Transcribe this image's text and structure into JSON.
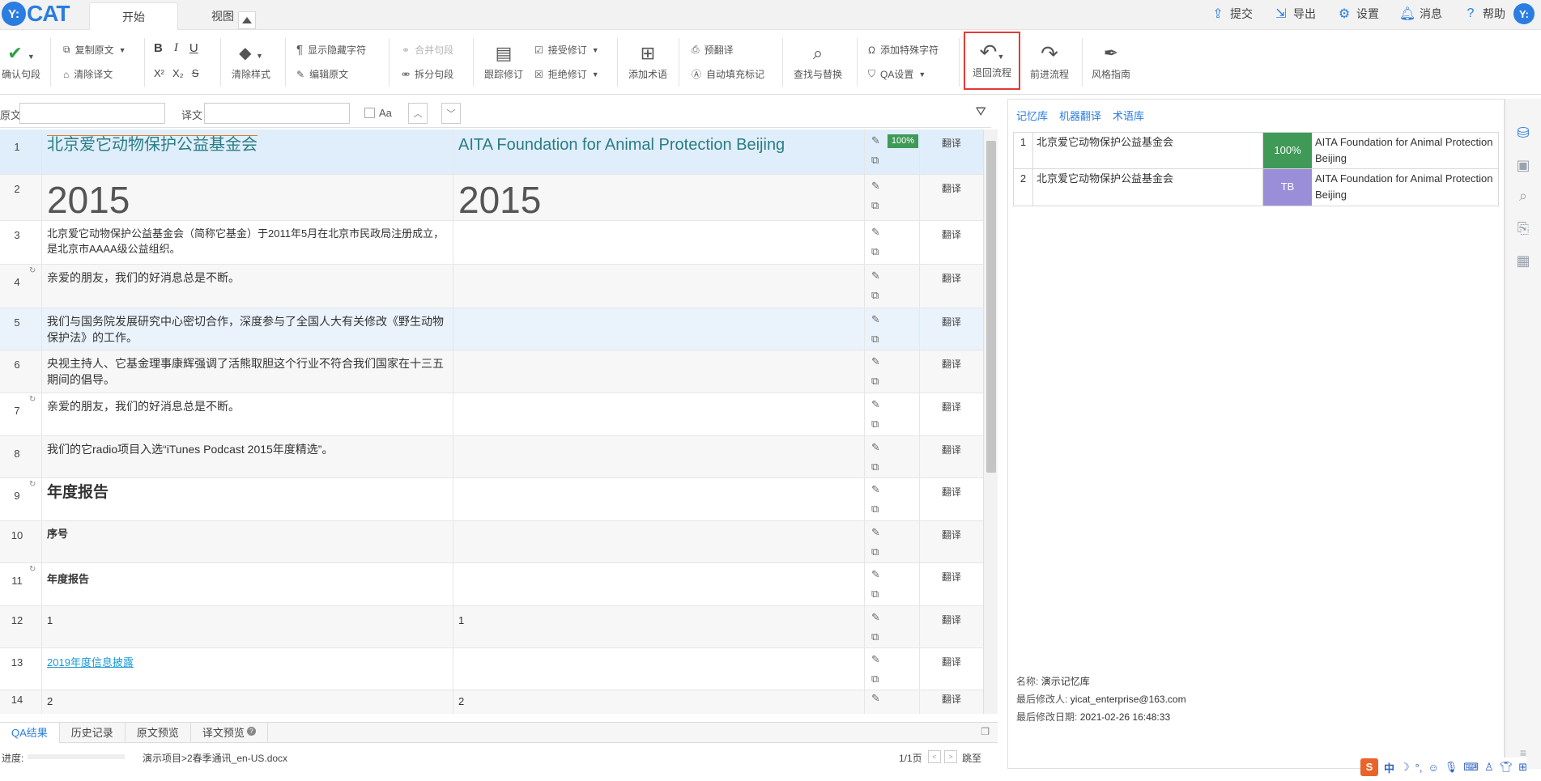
{
  "app": {
    "logo_text": "CAT",
    "logo_badge": "Y:",
    "avatar": "Y:"
  },
  "tabs": [
    {
      "label": "开始",
      "active": true
    },
    {
      "label": "视图",
      "active": false
    }
  ],
  "top_actions": [
    {
      "label": "提交",
      "icon": "upload-icon"
    },
    {
      "label": "导出",
      "icon": "export-icon"
    },
    {
      "label": "设置",
      "icon": "gear-icon"
    },
    {
      "label": "消息",
      "icon": "bell-icon"
    },
    {
      "label": "帮助",
      "icon": "help-icon"
    }
  ],
  "toolbar": {
    "confirm": "确认句段",
    "copy_source": "复制原文",
    "clear_target": "清除译文",
    "clear_style": "清除样式",
    "show_hidden": "显示隐藏字符",
    "edit_source": "编辑原文",
    "merge": "合并句段",
    "split": "拆分句段",
    "track": "跟踪修订",
    "accept": "接受修订",
    "reject": "拒绝修订",
    "add_term": "添加术语",
    "pretranslate": "预翻译",
    "autofill": "自动填充标记",
    "find_replace": "查找与替换",
    "special_char": "添加特殊字符",
    "qa_settings": "QA设置",
    "rollback": "退回流程",
    "forward": "前进流程",
    "style_guide": "风格指南",
    "format_labels": {
      "bold": "B",
      "italic": "I",
      "underline": "U",
      "superscript": "X²",
      "subscript": "X₂",
      "strike": "S"
    }
  },
  "search": {
    "source_label": "原文",
    "target_label": "译文",
    "case_label": "Aa"
  },
  "segments": [
    {
      "num": "1",
      "source": "北京爱它动物保护公益基金会",
      "target": "AITA Foundation for Animal Protection Beijing",
      "match": "100%",
      "status": "翻译"
    },
    {
      "num": "2",
      "source": "2015",
      "target": "2015",
      "status": "翻译"
    },
    {
      "num": "3",
      "source": "北京爱它动物保护公益基金会（简称它基金）于2011年5月在北京市民政局注册成立，是北京市AAAA级公益组织。",
      "target": "",
      "status": "翻译"
    },
    {
      "num": "4",
      "source": "亲爱的朋友，我们的好消息总是不断。",
      "target": "",
      "status": "翻译"
    },
    {
      "num": "5",
      "source": "我们与国务院发展研究中心密切合作，深度参与了全国人大有关修改《野生动物保护法》的工作。",
      "target": "",
      "status": "翻译"
    },
    {
      "num": "6",
      "source": "央视主持人、它基金理事康辉强调了活熊取胆这个行业不符合我们国家在十三五期间的倡导。",
      "target": "",
      "status": "翻译"
    },
    {
      "num": "7",
      "source": "亲爱的朋友，我们的好消息总是不断。",
      "target": "",
      "status": "翻译"
    },
    {
      "num": "8",
      "source": "我们的它radio项目入选“iTunes Podcast 2015年度精选”。",
      "target": "",
      "status": "翻译"
    },
    {
      "num": "9",
      "source": "年度报告",
      "target": "",
      "status": "翻译"
    },
    {
      "num": "10",
      "source": "序号",
      "target": "",
      "status": "翻译"
    },
    {
      "num": "11",
      "source": "年度报告",
      "target": "",
      "status": "翻译"
    },
    {
      "num": "12",
      "source": "1",
      "target": "1",
      "status": "翻译"
    },
    {
      "num": "13",
      "source": "2019年度信息披露",
      "target": "",
      "status": "翻译"
    },
    {
      "num": "14",
      "source": "2",
      "target": "2",
      "status": "翻译"
    }
  ],
  "bottom_tabs": [
    {
      "label": "QA结果",
      "active": true
    },
    {
      "label": "历史记录",
      "active": false
    },
    {
      "label": "原文预览",
      "active": false
    },
    {
      "label": "译文预览",
      "active": false
    }
  ],
  "status": {
    "progress_label": "进度:",
    "path": "演示项目>2春季通讯_en-US.docx",
    "page": "1/1页",
    "jump": "跳至"
  },
  "right_panel": {
    "tabs": [
      "记忆库",
      "机器翻译",
      "术语库"
    ],
    "matches": [
      {
        "num": "1",
        "source": "北京爱它动物保护公益基金会",
        "score": "100%",
        "target": "AITA Foundation for Animal Protection Beijing",
        "color": "#3f9a57"
      },
      {
        "num": "2",
        "source": "北京爱它动物保护公益基金会",
        "score": "TB",
        "target": "AITA Foundation for Animal Protection Beijing",
        "color": "#9b8ed8"
      }
    ],
    "info": {
      "name_label": "名称:",
      "name": "演示记忆库",
      "modifier_label": "最后修改人:",
      "modifier": "yicat_enterprise@163.com",
      "date_label": "最后修改日期:",
      "date": "2021-02-26 16:48:33"
    }
  },
  "ime": {
    "lang": "中"
  }
}
